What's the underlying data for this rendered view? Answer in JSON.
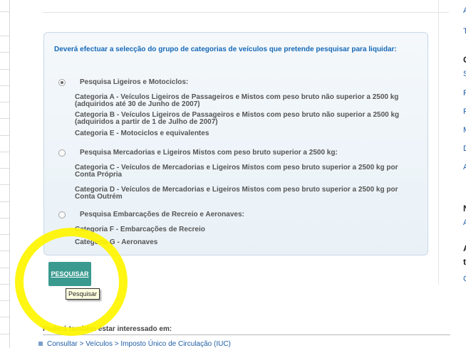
{
  "panel": {
    "title": "Deverá efectuar a selecção do grupo de categorias de veículos que pretende pesquisar para liquidar:",
    "options": [
      {
        "label": "Pesquisa Ligeiros e Motociclos:",
        "selected": true,
        "categories": [
          "Categoria A - Veículos Ligeiros de Passageiros e Mistos com peso bruto não superior a 2500 kg (adquiridos até 30 de Junho de 2007)",
          "Categoria B - Veículos Ligeiros de Passageiros e Mistos com peso bruto não superior a 2500 kg (adquiridos a partir de 1 de Julho de 2007)",
          "Categoria E - Motociclos e equivalentes"
        ]
      },
      {
        "label": "Pesquisa Mercadorias e Ligeiros Mistos com peso bruto superior a 2500 kg:",
        "selected": false,
        "categories": [
          "Categoria C - Veículos de Mercadorias e Ligeiros Mistos com peso bruto superior a 2500 kg por Conta Própria",
          "Categoria D - Veículos de Mercadorias e Ligeiros Mistos com peso bruto superior a 2500 kg por Conta Outrém"
        ]
      },
      {
        "label": "Pesquisa Embarcações de Recreio e Aeronaves:",
        "selected": false,
        "categories": [
          "Categoria F - Embarcações de Recreio",
          "Categoria G - Aeronaves"
        ]
      }
    ]
  },
  "search_button": {
    "label": "PESQUISAR",
    "tooltip": "Pesquisar"
  },
  "interest": {
    "title": "Poderá também estar interessado em:",
    "link": "Consultar > Veículos > Imposto Único de Circulação (IUC)"
  },
  "right_column": [
    "A",
    "T",
    "C",
    "S",
    "F",
    "F",
    "M",
    "D",
    "A",
    "N",
    "A",
    "A",
    "t",
    "C"
  ],
  "colors": {
    "accent": "#1769b8",
    "button": "#3a9a8f",
    "highlight": "#fff500"
  }
}
